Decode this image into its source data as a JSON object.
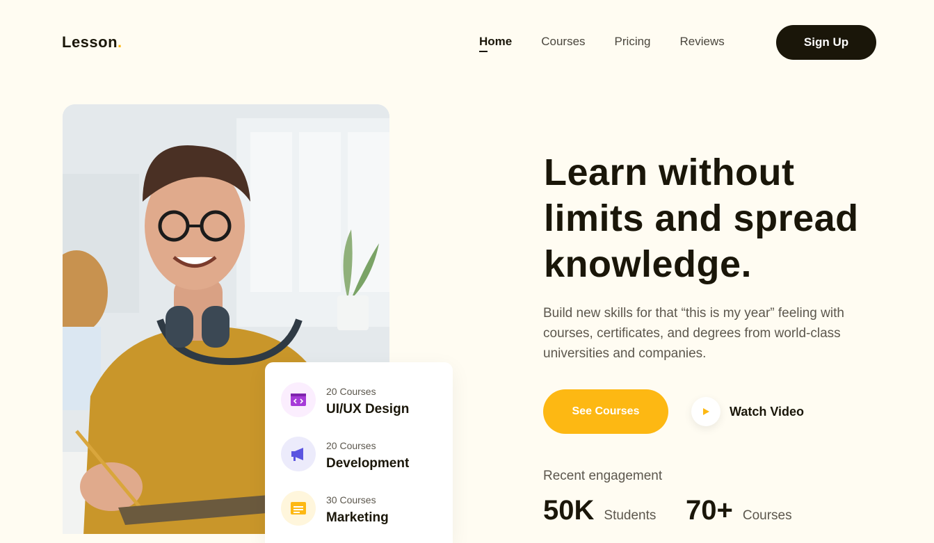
{
  "header": {
    "logo_text": "Lesson",
    "logo_dot": ".",
    "nav": [
      {
        "label": "Home",
        "active": true
      },
      {
        "label": "Courses",
        "active": false
      },
      {
        "label": "Pricing",
        "active": false
      },
      {
        "label": "Reviews",
        "active": false
      }
    ],
    "signup_label": "Sign Up"
  },
  "hero": {
    "headline": "Learn without limits and spread knowledge.",
    "subtext": "Build new skills for that “this is my year” feeling with courses, certificates, and degrees from world-class universities and companies.",
    "primary_cta": "See Courses",
    "secondary_cta": "Watch Video",
    "engagement_label": "Recent engagement",
    "stats": [
      {
        "value": "50K",
        "label": "Students"
      },
      {
        "value": "70+",
        "label": "Courses"
      }
    ]
  },
  "categories": [
    {
      "count": "20 Courses",
      "name": "UI/UX Design",
      "icon": "code-window-icon",
      "icon_color": "#a63bd8",
      "icon_bg": "#fbeefe"
    },
    {
      "count": "20 Courses",
      "name": "Development",
      "icon": "megaphone-icon",
      "icon_color": "#5b55e0",
      "icon_bg": "#ecebfb"
    },
    {
      "count": "30 Courses",
      "name": "Marketing",
      "icon": "document-icon",
      "icon_color": "#fdb813",
      "icon_bg": "#fff6dc"
    }
  ],
  "colors": {
    "background": "#fffcf2",
    "text_dark": "#1a1609",
    "accent": "#fdb813",
    "muted_text": "#5c574d"
  }
}
